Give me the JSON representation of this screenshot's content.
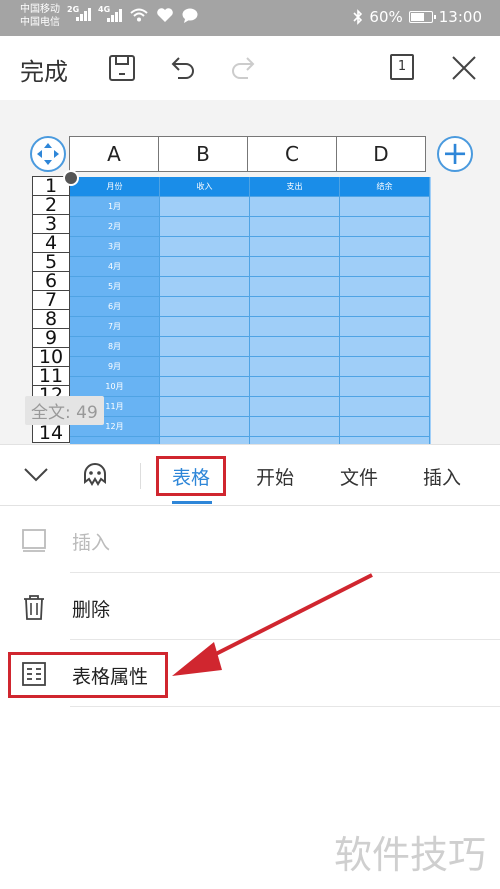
{
  "status": {
    "carrier1": "中国移动",
    "carrier2": "中国电信",
    "net1": "2G",
    "net2": "4G",
    "battery": "60%",
    "battery_level": 0.6,
    "time": "13:00"
  },
  "toolbar": {
    "done_label": "完成",
    "page_indicator": "1"
  },
  "sheet": {
    "columns": [
      "A",
      "B",
      "C",
      "D"
    ],
    "rows": [
      "1",
      "2",
      "3",
      "4",
      "5",
      "6",
      "7",
      "8",
      "9",
      "10",
      "11",
      "12",
      "13",
      "14"
    ],
    "header_cells": [
      "月份",
      "收入",
      "支出",
      "结余"
    ],
    "months": [
      "1月",
      "2月",
      "3月",
      "4月",
      "5月",
      "6月",
      "7月",
      "8月",
      "9月",
      "10月",
      "11月",
      "12月"
    ],
    "word_count": "全文: 49"
  },
  "tabs": {
    "items": [
      "表格",
      "开始",
      "文件",
      "插入"
    ],
    "active": "表格"
  },
  "menu": {
    "insert": "插入",
    "delete": "删除",
    "table_props": "表格属性"
  },
  "watermark": "软件技巧",
  "colors": {
    "accent": "#2e86d8",
    "highlight": "#d0262f",
    "table_header": "#1a8de8",
    "table_body": "#9fcef8"
  }
}
